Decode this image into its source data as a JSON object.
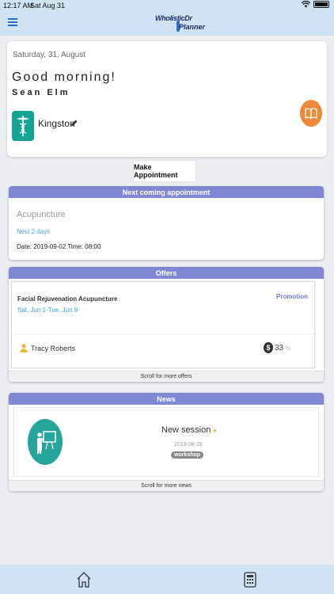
{
  "status_bar": {
    "time": "12:17 AM",
    "date": "Sat Aug 31"
  },
  "app": {
    "logo_line1": "WholisticDr",
    "logo_line2": "Planner"
  },
  "greeting": {
    "date": "Saturday, 31, August",
    "hello": "Good morning!",
    "name": "Sean Elm",
    "clinic": "Kingston"
  },
  "make_appointment_label": "Make Appointment",
  "next_appointment": {
    "header": "Next coming appointment",
    "type": "Acupuncture",
    "when": "Next 2 days",
    "datetime": "Date: 2019-09-02 Time: 08:00"
  },
  "offers": {
    "header": "Offers",
    "items": [
      {
        "title": "Facial Rejuvenation Acupuncture",
        "dates": "Sat, Jun 1-Tue, Jun 9",
        "badge": "Promotion",
        "practitioner": "Tracy Roberts",
        "discount": "33",
        "percent_sign": "%"
      }
    ],
    "scroll_hint": "Scroll for more offers"
  },
  "news": {
    "header": "News",
    "items": [
      {
        "title": "New session",
        "date": "2019-08-28",
        "tag": "workshop"
      }
    ],
    "scroll_hint": "Scroll for more news"
  },
  "tabs": [
    {
      "icon": "home-icon"
    },
    {
      "icon": "calendar-icon"
    }
  ],
  "colors": {
    "header_bg": "#cfe3f4",
    "panel_header": "#8087d5",
    "accent_blue": "#3c9ae4",
    "book_orange": "#ef8a3a",
    "clinic_teal": "#13a594"
  }
}
